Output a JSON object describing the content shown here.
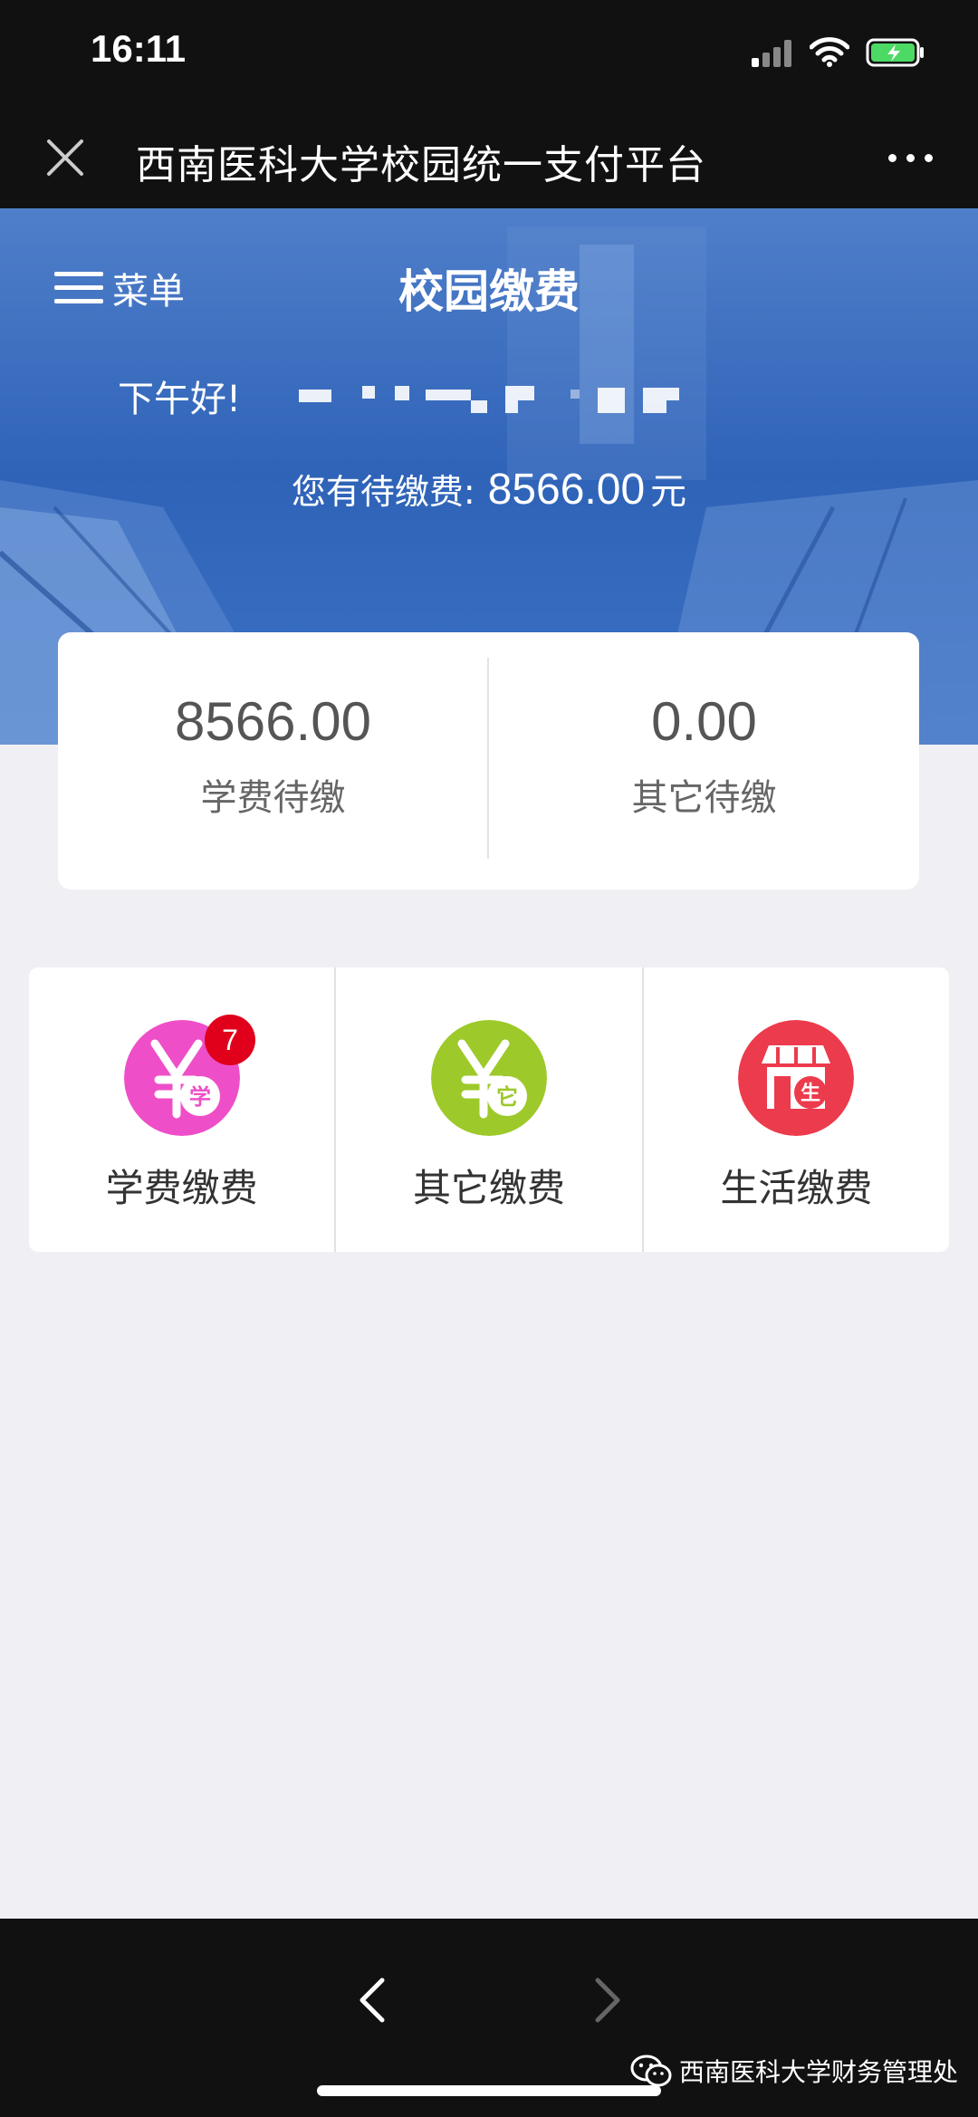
{
  "status_bar": {
    "time": "16:11"
  },
  "nav": {
    "title": "西南医科大学校园统一支付平台"
  },
  "banner": {
    "menu_label": "菜单",
    "title": "校园缴费",
    "greeting": "下午好!",
    "pending_label": "您有待缴费:",
    "pending_amount": "8566.00",
    "pending_unit": "元"
  },
  "summary": {
    "items": [
      {
        "value": "8566.00",
        "label": "学费待缴"
      },
      {
        "value": "0.00",
        "label": "其它待缴"
      }
    ]
  },
  "pay_grid": {
    "items": [
      {
        "label": "学费缴费",
        "icon": "tuition-yuan-icon",
        "badge": "7",
        "color": "#ee4fc8",
        "glyph": "学"
      },
      {
        "label": "其它缴费",
        "icon": "other-yuan-icon",
        "color": "#9dc92a",
        "glyph": "它"
      },
      {
        "label": "生活缴费",
        "icon": "shop-icon",
        "color": "#ec3b4c",
        "glyph": "生"
      }
    ]
  },
  "watermark": "西南医科大学财务管理处",
  "colors": {
    "banner": "#2f63b8",
    "background": "#efeff4",
    "dark_bar": "#111111",
    "badge": "#e0001b"
  }
}
